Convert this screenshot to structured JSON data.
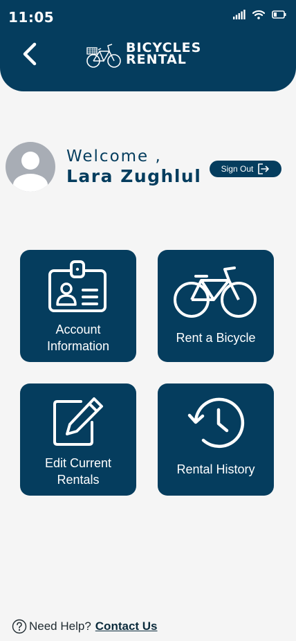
{
  "status_bar": {
    "time": "11:05"
  },
  "header": {
    "brand_line1": "BICYCLES",
    "brand_line2": "RENTAL"
  },
  "profile": {
    "greeting": "Welcome ,",
    "name": "Lara Zughlul",
    "sign_out_label": "Sign Out"
  },
  "tiles": [
    {
      "line1": "Account",
      "line2": "Information",
      "icon": "id-badge-icon"
    },
    {
      "line1": "Rent a Bicycle",
      "line2": "",
      "icon": "bicycle-icon"
    },
    {
      "line1": "Edit Current",
      "line2": "Rentals",
      "icon": "edit-icon"
    },
    {
      "line1": "Rental History",
      "line2": "",
      "icon": "history-icon"
    }
  ],
  "footer": {
    "help_text": "Need Help?",
    "contact_link": "Contact Us"
  },
  "colors": {
    "primary": "#053d5e",
    "background": "#f5f5f5",
    "avatar": "#a8adb5"
  }
}
